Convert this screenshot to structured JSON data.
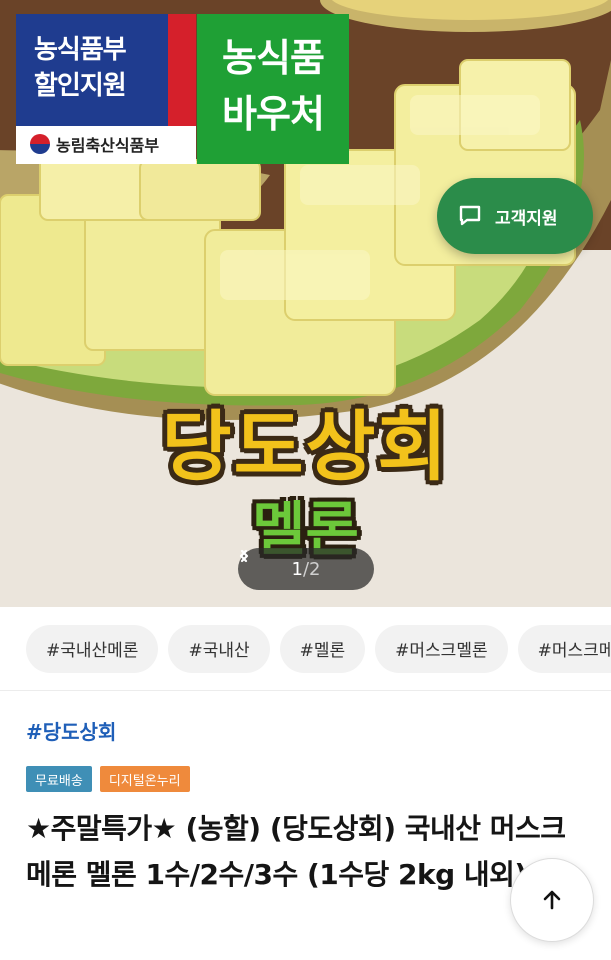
{
  "hero": {
    "gov_badge_line1": "농식품부",
    "gov_badge_line2": "할인지원",
    "gov_ministry": "농림축산식품부",
    "voucher_line1": "농식품",
    "voucher_line2": "바우처",
    "support_label": "고객지원",
    "brand_title": "당도상회",
    "brand_sub": "멜론",
    "pager_current": "1",
    "pager_separator": "/",
    "pager_total": "2",
    "prev_icon": "chevron-left-icon",
    "next_icon": "chevron-right-icon"
  },
  "tags": [
    "#국내산메론",
    "#국내산",
    "#멜론",
    "#머스크멜론",
    "#머스크메"
  ],
  "product": {
    "brand_link": "#당도상회",
    "badges": [
      {
        "label": "무료배송",
        "color": "#3f8fb6"
      },
      {
        "label": "디지털온누리",
        "color": "#ef8a3c"
      }
    ],
    "title": "★주말특가★ (농할) (당도상회) 국내산 머스크 메론 멜론 1수/2수/3수 (1수당 2kg 내외)"
  },
  "scroll_top_icon": "arrow-up-icon",
  "colors": {
    "gov_blue": "#1f3c8f",
    "voucher_green": "#1fa035",
    "support_green": "#2b8c4a",
    "brand_link_blue": "#1f5fb8"
  }
}
